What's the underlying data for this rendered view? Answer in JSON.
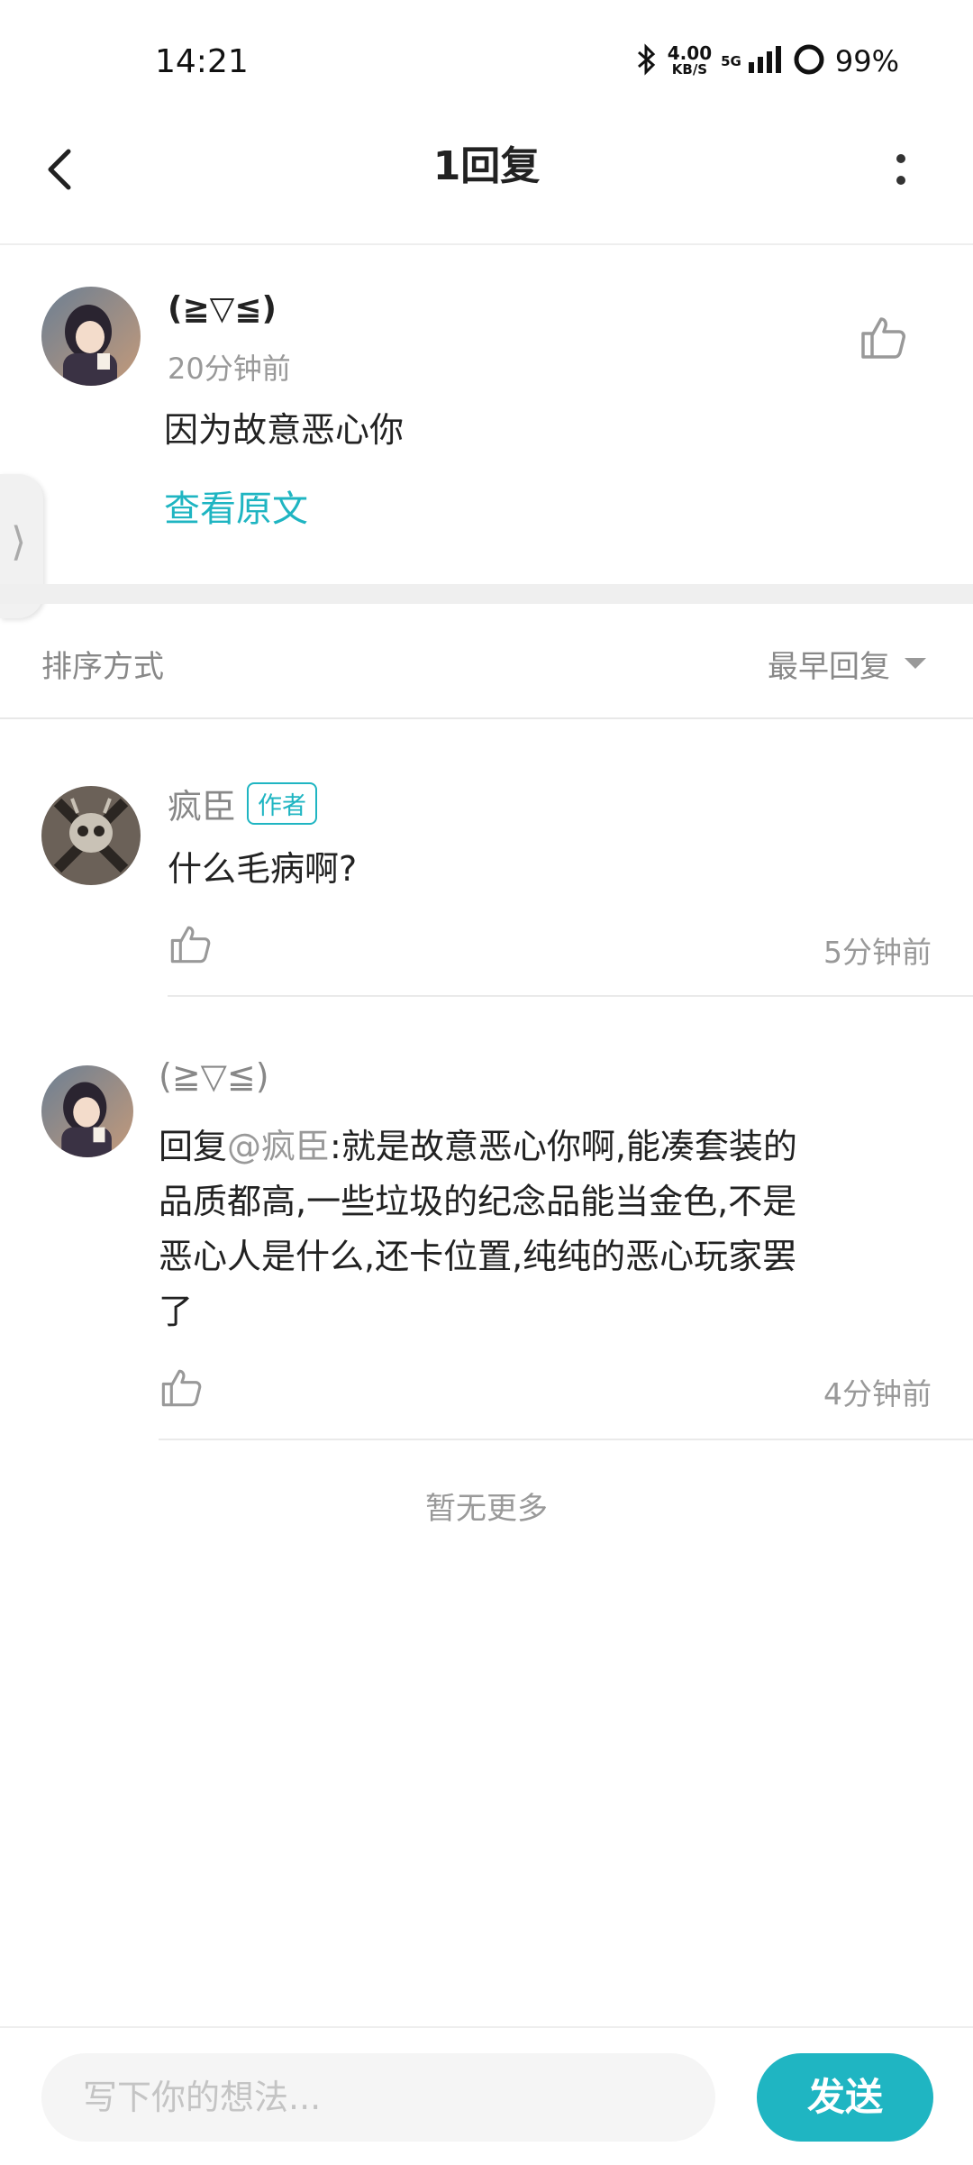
{
  "status_bar": {
    "time": "14:21",
    "net_speed": "4.00",
    "net_unit": "KB/S",
    "network": "5G",
    "battery": "99%"
  },
  "nav": {
    "title": "1回复",
    "back_icon": "chevron-left-icon",
    "more_icon": "more-vertical-icon"
  },
  "main_comment": {
    "author": "(≧▽≦)",
    "time": "20分钟前",
    "text": "因为故意恶心你",
    "view_original": "查看原文"
  },
  "sort": {
    "label": "排序方式",
    "value": "最早回复"
  },
  "replies": [
    {
      "author": "疯臣",
      "badge": "作者",
      "text": "什么毛病啊?",
      "time": "5分钟前"
    },
    {
      "author": "(≧▽≦)",
      "reply_prefix": "回复",
      "reply_to": "@疯臣",
      "text_line_1": ":就是故意恶心你啊,能凑套装的",
      "text_line_2": "品质都高,一些垃圾的纪念品能当金色,不是",
      "text_line_3": "恶心人是什么,还卡位置,纯纯的恶心玩家罢",
      "text_line_4": "了",
      "time": "4分钟前"
    }
  ],
  "no_more": "暂无更多",
  "composer": {
    "placeholder": "写下你的想法...",
    "send_label": "发送"
  },
  "colors": {
    "accent": "#1fb5c2",
    "muted_text": "#999999",
    "divider": "#efefef"
  }
}
